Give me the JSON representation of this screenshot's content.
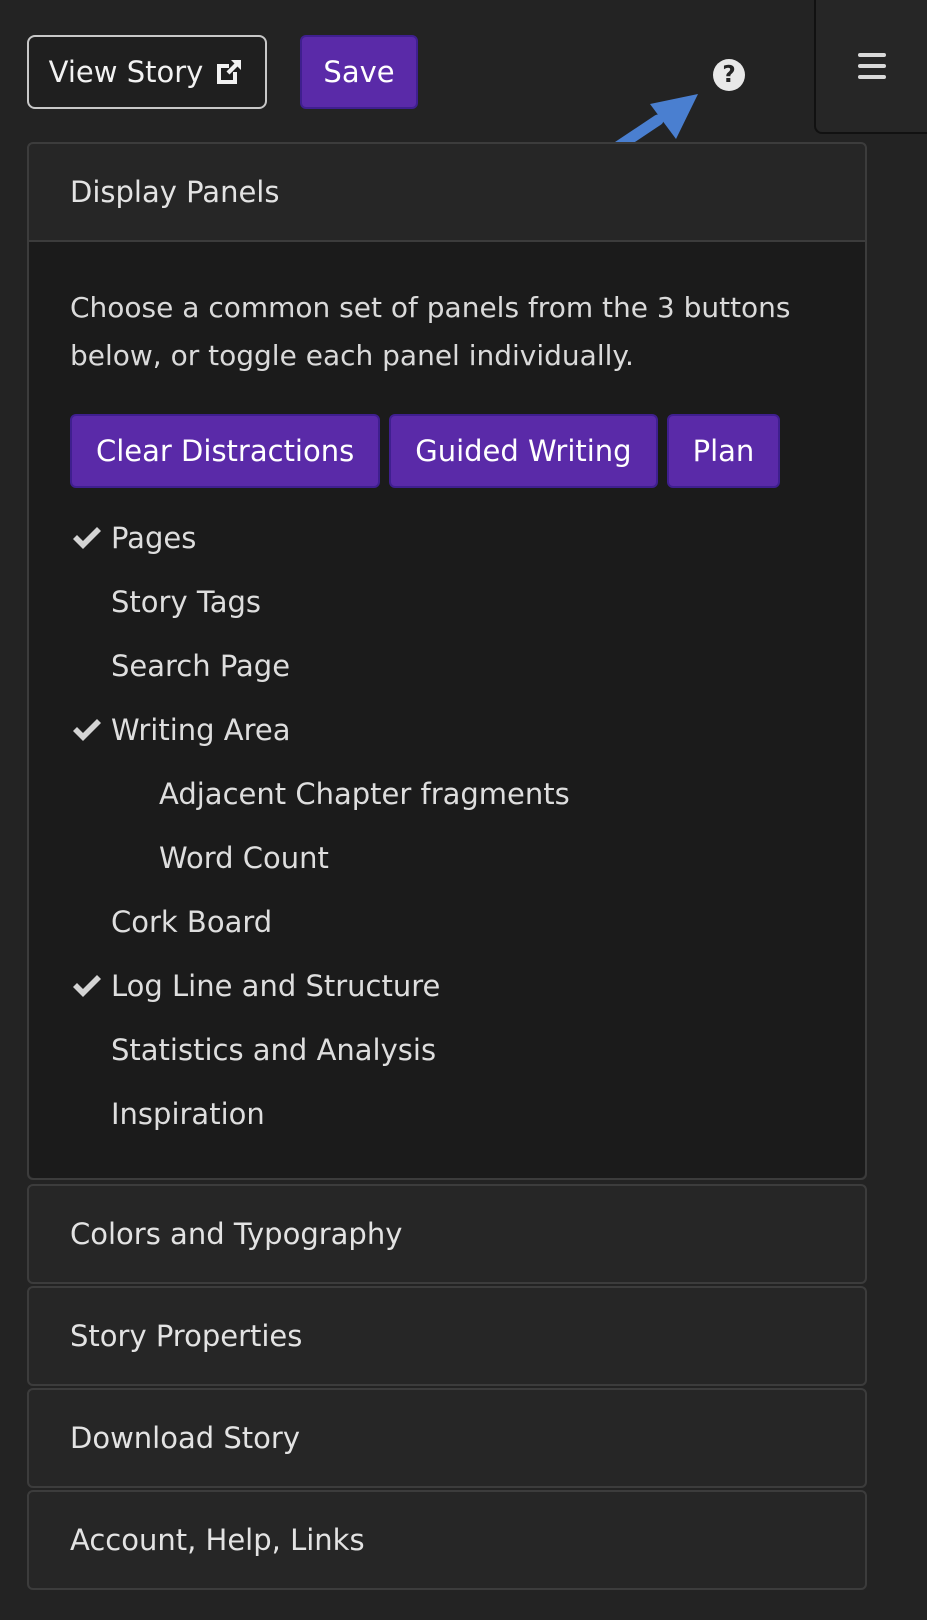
{
  "toolbar": {
    "view_story_label": "View Story",
    "save_label": "Save",
    "help_label": "?"
  },
  "display_panels": {
    "title": "Display Panels",
    "description": "Choose a common set of panels from the 3 buttons below, or toggle each panel individually.",
    "presets": [
      "Clear Distractions",
      "Guided Writing",
      "Plan"
    ],
    "options": [
      {
        "label": "Pages",
        "checked": true,
        "indent": 0
      },
      {
        "label": "Story Tags",
        "checked": false,
        "indent": 0
      },
      {
        "label": "Search Page",
        "checked": false,
        "indent": 0
      },
      {
        "label": "Writing Area",
        "checked": true,
        "indent": 0
      },
      {
        "label": "Adjacent Chapter fragments",
        "checked": false,
        "indent": 1
      },
      {
        "label": "Word Count",
        "checked": false,
        "indent": 1
      },
      {
        "label": "Cork Board",
        "checked": false,
        "indent": 0
      },
      {
        "label": "Log Line and Structure",
        "checked": true,
        "indent": 0
      },
      {
        "label": "Statistics and Analysis",
        "checked": false,
        "indent": 0
      },
      {
        "label": "Inspiration",
        "checked": false,
        "indent": 0
      }
    ]
  },
  "sections": [
    "Colors and Typography",
    "Story Properties",
    "Download Story",
    "Account, Help, Links"
  ],
  "colors": {
    "accent": "#5a2aa8",
    "arrow": "#4a7fd0"
  },
  "icons": {
    "view_story": "external-link-icon",
    "help": "question-circle-icon",
    "menu": "hamburger-menu-icon",
    "check": "check-icon"
  }
}
